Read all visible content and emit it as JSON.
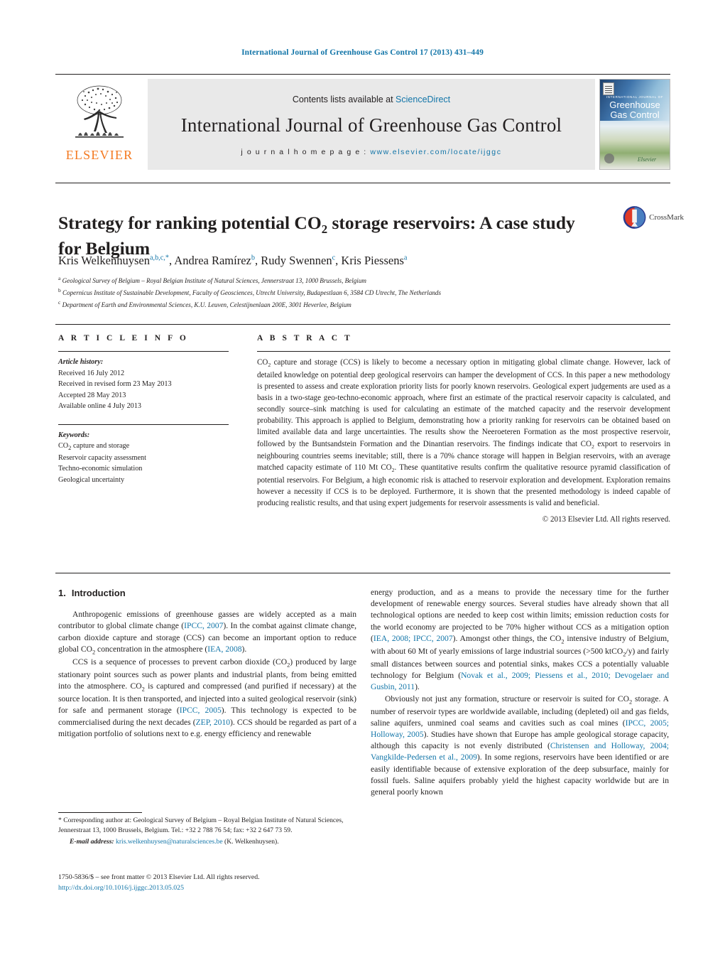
{
  "running_head": "International Journal of Greenhouse Gas Control 17 (2013) 431–449",
  "masthead": {
    "publisher_name": "ELSEVIER",
    "contents_prefix": "Contents lists available at ",
    "contents_link": "ScienceDirect",
    "journal_name": "International Journal of Greenhouse Gas Control",
    "homepage_prefix": "j o u r n a l   h o m e p a g e :   ",
    "homepage_url": "www.elsevier.com/locate/ijggc",
    "cover": {
      "kicker": "INTERNATIONAL JOURNAL OF",
      "line1": "Greenhouse",
      "line2": "Gas Control",
      "publisher_mark": "Elsevier"
    }
  },
  "article": {
    "title_part1": "Strategy for ranking potential CO",
    "title_sub": "2",
    "title_part2": " storage reservoirs: A case study for Belgium",
    "crossmark_label": "CrossMark",
    "authors_html": "Kris Welkenhuysen<sup>a,b,c,</sup><sup class=\"star\">*</sup>, Andrea Ramírez<sup>b</sup>, Rudy Swennen<sup>c</sup>, Kris Piessens<sup>a</sup>",
    "affiliations": [
      {
        "marker": "a",
        "text": "Geological Survey of Belgium – Royal Belgian Institute of Natural Sciences, Jennerstraat 13, 1000 Brussels, Belgium"
      },
      {
        "marker": "b",
        "text": "Copernicus Institute of Sustainable Development, Faculty of Geosciences, Utrecht University, Budapestlaan 6, 3584 CD Utrecht, The Netherlands"
      },
      {
        "marker": "c",
        "text": "Department of Earth and Environmental Sciences, K.U. Leuven, Celestijnenlaan 200E, 3001 Heverlee, Belgium"
      }
    ]
  },
  "article_info": {
    "heading": "A R T I C L E   I N F O",
    "history_label": "Article history:",
    "history": [
      "Received 16 July 2012",
      "Received in revised form 23 May 2013",
      "Accepted 28 May 2013",
      "Available online 4 July 2013"
    ],
    "keywords_label": "Keywords:",
    "keywords_html": [
      "CO<sub>2</sub> capture and storage",
      "Reservoir capacity assessment",
      "Techno-economic simulation",
      "Geological uncertainty"
    ]
  },
  "abstract": {
    "heading": "A B S T R A C T",
    "text_html": "CO<sub>2</sub> capture and storage (CCS) is likely to become a necessary option in mitigating global climate change. However, lack of detailed knowledge on potential deep geological reservoirs can hamper the development of CCS. In this paper a new methodology is presented to assess and create exploration priority lists for poorly known reservoirs. Geological expert judgements are used as a basis in a two-stage geo-techno-economic approach, where first an estimate of the practical reservoir capacity is calculated, and secondly source–sink matching is used for calculating an estimate of the matched capacity and the reservoir development probability. This approach is applied to Belgium, demonstrating how a priority ranking for reservoirs can be obtained based on limited available data and large uncertainties. The results show the Neeroeteren Formation as the most prospective reservoir, followed by the Buntsandstein Formation and the Dinantian reservoirs. The findings indicate that CO<sub>2</sub> export to reservoirs in neighbouring countries seems inevitable; still, there is a 70% chance storage will happen in Belgian reservoirs, with an average matched capacity estimate of 110 Mt CO<sub>2</sub>. These quantitative results confirm the qualitative resource pyramid classification of potential reservoirs. For Belgium, a high economic risk is attached to reservoir exploration and development. Exploration remains however a necessity if CCS is to be deployed. Furthermore, it is shown that the presented methodology is indeed capable of producing realistic results, and that using expert judgements for reservoir assessments is valid and beneficial.",
    "copyright": "© 2013 Elsevier Ltd. All rights reserved."
  },
  "body": {
    "section_number": "1.",
    "section_title": "Introduction",
    "left_paragraphs_html": [
      "Anthropogenic emissions of greenhouse gasses are widely accepted as a main contributor to global climate change (<span class=\"ref\">IPCC, 2007</span>). In the combat against climate change, carbon dioxide capture and storage (CCS) can become an important option to reduce global CO<sub>2</sub> concentration in the atmosphere (<span class=\"ref\">IEA, 2008</span>).",
      "CCS is a sequence of processes to prevent carbon dioxide (CO<sub>2</sub>) produced by large stationary point sources such as power plants and industrial plants, from being emitted into the atmosphere. CO<sub>2</sub> is captured and compressed (and purified if necessary) at the source location. It is then transported, and injected into a suited geological reservoir (sink) for safe and permanent storage (<span class=\"ref\">IPCC, 2005</span>). This technology is expected to be commercialised during the next decades (<span class=\"ref\">ZEP, 2010</span>). CCS should be regarded as part of a mitigation portfolio of solutions next to e.g. energy efficiency and renewable"
    ],
    "right_paragraphs_html": [
      "energy production, and as a means to provide the necessary time for the further development of renewable energy sources. Several studies have already shown that all technological options are needed to keep cost within limits; emission reduction costs for the world economy are projected to be 70% higher without CCS as a mitigation option (<span class=\"ref\">IEA, 2008; IPCC, 2007</span>). Amongst other things, the CO<sub>2</sub> intensive industry of Belgium, with about 60 Mt of yearly emissions of large industrial sources (&gt;500 ktCO<sub>2</sub>/y) and fairly small distances between sources and potential sinks, makes CCS a potentially valuable technology for Belgium (<span class=\"ref\">Novak et al., 2009; Piessens et al., 2010; Devogelaer and Gusbin, 2011</span>).",
      "Obviously not just any formation, structure or reservoir is suited for CO<sub>2</sub> storage. A number of reservoir types are worldwide available, including (depleted) oil and gas fields, saline aquifers, unmined coal seams and cavities such as coal mines (<span class=\"ref\">IPCC, 2005; Holloway, 2005</span>). Studies have shown that Europe has ample geological storage capacity, although this capacity is not evenly distributed (<span class=\"ref\">Christensen and Holloway, 2004; Vangkilde-Pedersen et al., 2009</span>). In some regions, reservoirs have been identified or are easily identifiable because of extensive exploration of the deep subsurface, mainly for fossil fuels. Saline aquifers probably yield the highest capacity worldwide but are in general poorly known"
    ]
  },
  "footnote": {
    "corresponding_html": "* Corresponding author at: Geological Survey of Belgium – Royal Belgian Institute of Natural Sciences, Jennerstraat 13, 1000 Brussels, Belgium. Tel.: +32 2 788 76 54; fax: +32 2 647 73 59.",
    "email_label": "E-mail address:",
    "email": "kris.welkenhuysen@naturalsciences.be",
    "email_owner": " (K. Welkenhuysen)."
  },
  "imprint": {
    "line1": "1750-5836/$ – see front matter © 2013 Elsevier Ltd. All rights reserved.",
    "doi": "http://dx.doi.org/10.1016/j.ijggc.2013.05.025"
  },
  "colors": {
    "link": "#1275a8",
    "elsevier_orange": "#f47920",
    "band_gray": "#e9e9e9",
    "text": "#221f1f"
  }
}
